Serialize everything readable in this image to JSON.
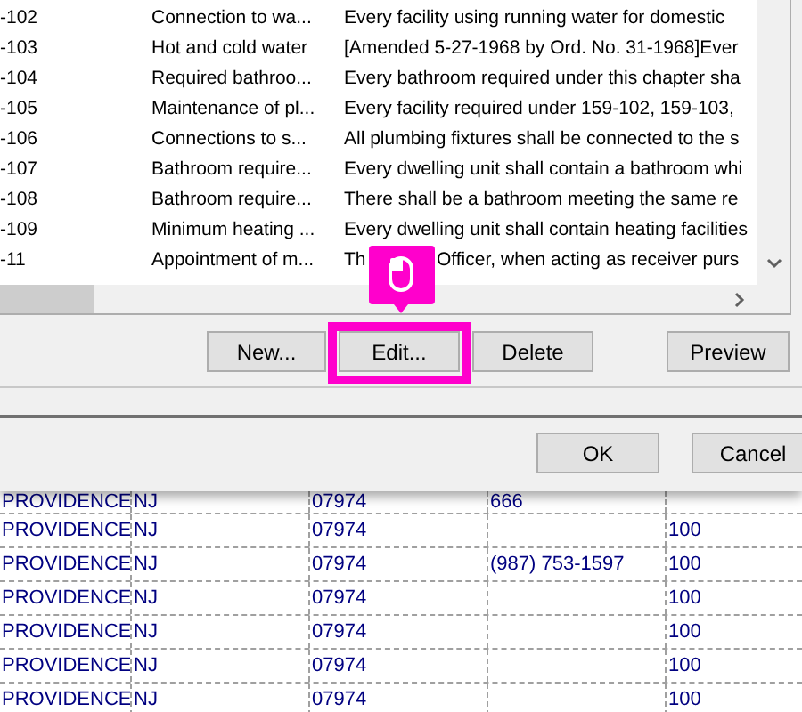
{
  "list": {
    "rows": [
      {
        "number": "-102",
        "title": "Connection to wa...",
        "text": "Every facility using running water for domestic"
      },
      {
        "number": "-103",
        "title": "Hot and cold water",
        "text": "[Amended 5-27-1968 by Ord. No. 31-1968]Ever"
      },
      {
        "number": "-104",
        "title": "Required bathroo...",
        "text": "Every bathroom required under this chapter sha"
      },
      {
        "number": "-105",
        "title": "Maintenance of pl...",
        "text": "Every facility required under  159-102, 159-103,"
      },
      {
        "number": "-106",
        "title": "Connections to s...",
        "text": "All plumbing fixtures shall be connected to the s"
      },
      {
        "number": "-107",
        "title": "Bathroom require...",
        "text": "Every dwelling unit shall contain a bathroom whi"
      },
      {
        "number": "-108",
        "title": "Bathroom require...",
        "text": "There shall be a bathroom meeting the same re"
      },
      {
        "number": "-109",
        "title": "Minimum heating ...",
        "text": "Every dwelling unit shall contain heating facilities"
      },
      {
        "number": "-11",
        "title": "Appointment of m...",
        "text": "Th",
        "text_after_cursor": "Officer, when acting as receiver purs"
      }
    ]
  },
  "buttons": [
    {
      "label": "New...",
      "highlighted": false
    },
    {
      "label": "Edit...",
      "highlighted": true
    },
    {
      "label": "Delete",
      "highlighted": false
    },
    {
      "label": "Preview",
      "highlighted": false
    }
  ],
  "dialog_buttons": [
    {
      "label": "OK"
    },
    {
      "label": "Cancel"
    }
  ],
  "grid": {
    "rows": [
      {
        "cells": [
          "PROVIDENCE",
          "NJ",
          "07974",
          "666",
          ""
        ]
      },
      {
        "cells": [
          "PROVIDENCE",
          "NJ",
          "07974",
          "",
          "100"
        ]
      },
      {
        "cells": [
          "PROVIDENCE",
          "NJ",
          "07974",
          "(987) 753-1597",
          "100"
        ]
      },
      {
        "cells": [
          "PROVIDENCE",
          "NJ",
          "07974",
          "",
          "100"
        ]
      },
      {
        "cells": [
          "PROVIDENCE",
          "NJ",
          "07974",
          "",
          "100"
        ]
      },
      {
        "cells": [
          "PROVIDENCE",
          "NJ",
          "07974",
          "",
          "100"
        ]
      },
      {
        "cells": [
          "PROVIDENCE",
          "NJ",
          "07974",
          "",
          "100"
        ]
      }
    ]
  }
}
